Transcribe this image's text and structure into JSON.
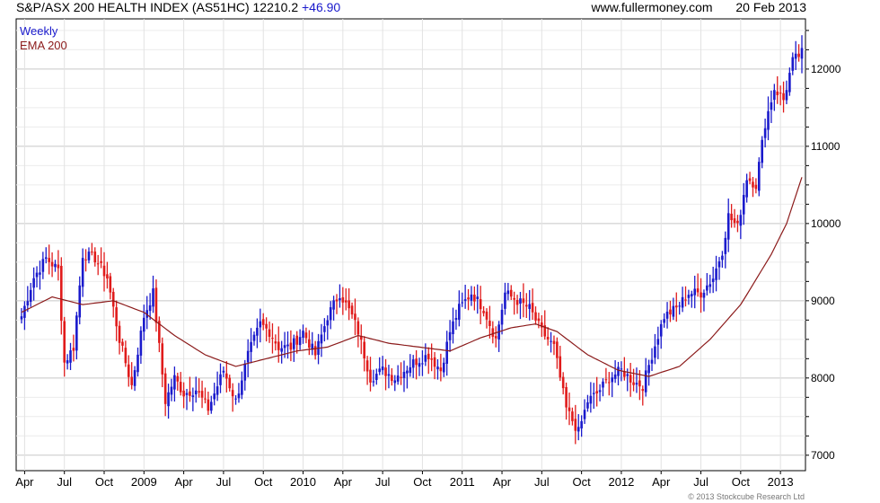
{
  "header": {
    "title": "S&P/ASX 200 HEALTH INDEX (AS51HC) 12210.2",
    "change": "+46.90",
    "site": "www.fullermoney.com",
    "date": "20 Feb 2013"
  },
  "legend": {
    "series1": "Weekly",
    "series2": "EMA 200"
  },
  "footer": {
    "copyright": "© 2013 Stockcube Research Ltd"
  },
  "colors": {
    "up": "#1a1acc",
    "down": "#e01b1b",
    "ema": "#8b1a1a",
    "grid": "#d8d8d8"
  },
  "chart_data": {
    "type": "candlestick",
    "frequency": "weekly",
    "grid": true,
    "ylim": [
      6800,
      12650
    ],
    "y_ticks": [
      7000,
      8000,
      9000,
      10000,
      11000,
      12000
    ],
    "x_ticks": [
      "Apr",
      "Jul",
      "Oct",
      "2009",
      "Apr",
      "Jul",
      "Oct",
      "2010",
      "Apr",
      "Jul",
      "Oct",
      "2011",
      "Apr",
      "Jul",
      "Oct",
      "2012",
      "Apr",
      "Jul",
      "Oct",
      "2013"
    ],
    "x_label_weeks": [
      1,
      14,
      27,
      40,
      53,
      66,
      79,
      92,
      105,
      118,
      131,
      144,
      157,
      170,
      183,
      196,
      209,
      222,
      235,
      248
    ],
    "anchors": [
      [
        0,
        8800
      ],
      [
        4,
        9300
      ],
      [
        8,
        9550
      ],
      [
        12,
        9400
      ],
      [
        14,
        8200
      ],
      [
        17,
        8400
      ],
      [
        20,
        9600
      ],
      [
        24,
        9550
      ],
      [
        28,
        9300
      ],
      [
        32,
        8500
      ],
      [
        36,
        7900
      ],
      [
        40,
        8800
      ],
      [
        43,
        9100
      ],
      [
        47,
        7700
      ],
      [
        50,
        8000
      ],
      [
        53,
        7800
      ],
      [
        57,
        7850
      ],
      [
        61,
        7600
      ],
      [
        66,
        8100
      ],
      [
        70,
        7700
      ],
      [
        74,
        8300
      ],
      [
        78,
        8700
      ],
      [
        81,
        8600
      ],
      [
        84,
        8400
      ],
      [
        88,
        8400
      ],
      [
        92,
        8600
      ],
      [
        96,
        8300
      ],
      [
        100,
        8800
      ],
      [
        104,
        9100
      ],
      [
        108,
        8800
      ],
      [
        110,
        8600
      ],
      [
        114,
        8000
      ],
      [
        118,
        8100
      ],
      [
        122,
        8000
      ],
      [
        128,
        8200
      ],
      [
        133,
        8300
      ],
      [
        137,
        8100
      ],
      [
        140,
        8600
      ],
      [
        143,
        8900
      ],
      [
        147,
        9100
      ],
      [
        151,
        8900
      ],
      [
        155,
        8500
      ],
      [
        158,
        9100
      ],
      [
        162,
        9000
      ],
      [
        166,
        8900
      ],
      [
        170,
        8600
      ],
      [
        174,
        8400
      ],
      [
        178,
        7600
      ],
      [
        182,
        7300
      ],
      [
        185,
        7700
      ],
      [
        188,
        7800
      ],
      [
        192,
        8000
      ],
      [
        196,
        8100
      ],
      [
        200,
        7950
      ],
      [
        203,
        7900
      ],
      [
        206,
        8300
      ],
      [
        210,
        8800
      ],
      [
        214,
        8900
      ],
      [
        218,
        9100
      ],
      [
        222,
        9100
      ],
      [
        226,
        9300
      ],
      [
        229,
        9650
      ],
      [
        231,
        10100
      ],
      [
        234,
        9950
      ],
      [
        237,
        10600
      ],
      [
        240,
        10500
      ],
      [
        243,
        11300
      ],
      [
        246,
        11750
      ],
      [
        249,
        11600
      ],
      [
        252,
        12100
      ],
      [
        255,
        12210
      ]
    ],
    "ema200": [
      [
        0,
        8850
      ],
      [
        10,
        9050
      ],
      [
        20,
        8950
      ],
      [
        30,
        9000
      ],
      [
        40,
        8850
      ],
      [
        50,
        8550
      ],
      [
        60,
        8300
      ],
      [
        70,
        8150
      ],
      [
        80,
        8250
      ],
      [
        90,
        8350
      ],
      [
        100,
        8400
      ],
      [
        110,
        8550
      ],
      [
        120,
        8450
      ],
      [
        130,
        8400
      ],
      [
        140,
        8350
      ],
      [
        150,
        8520
      ],
      [
        160,
        8650
      ],
      [
        168,
        8700
      ],
      [
        175,
        8600
      ],
      [
        185,
        8300
      ],
      [
        195,
        8100
      ],
      [
        205,
        8020
      ],
      [
        215,
        8150
      ],
      [
        225,
        8500
      ],
      [
        235,
        8950
      ],
      [
        245,
        9600
      ],
      [
        250,
        10000
      ],
      [
        255,
        10600
      ]
    ],
    "candle_count": 256
  }
}
